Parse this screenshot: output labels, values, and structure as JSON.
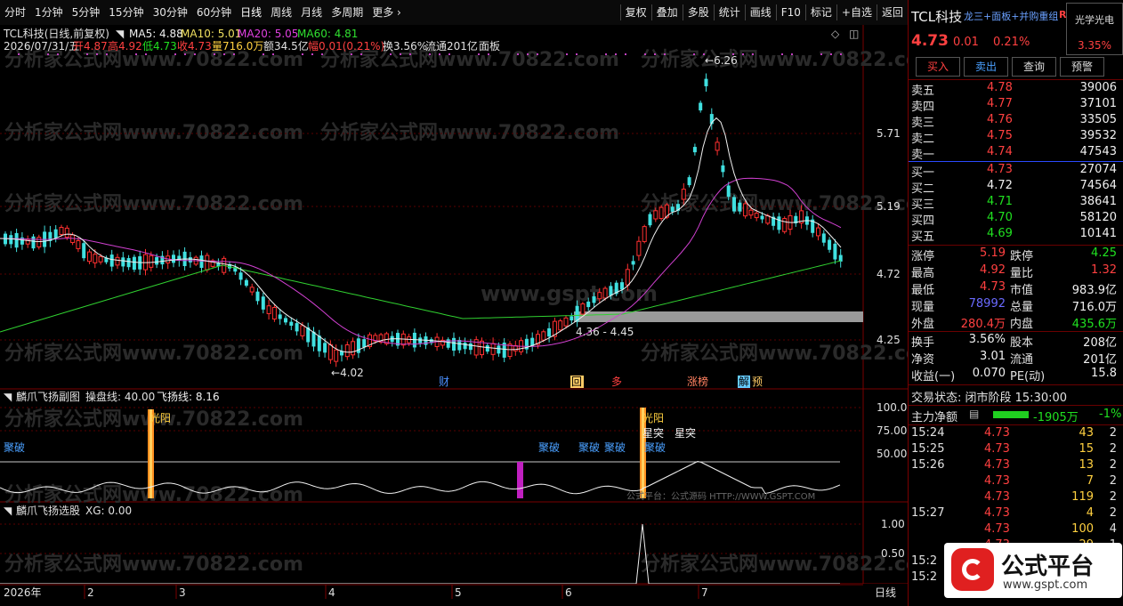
{
  "toolbar": {
    "tabs": [
      "分时",
      "1分钟",
      "5分钟",
      "15分钟",
      "30分钟",
      "60分钟",
      "日线",
      "周线",
      "月线",
      "多周期",
      "更多 ›"
    ],
    "active_tab": "日线",
    "tools": [
      "复权",
      "叠加",
      "多股",
      "统计",
      "画线",
      "F10",
      "标记",
      "+自选",
      "返回"
    ]
  },
  "main_chart": {
    "stock_line": "TCL科技(日线,前复权)",
    "ma5": "MA5: 4.88",
    "ma10": "MA10: 5.01",
    "ma20": "MA20: 5.05",
    "ma60": "MA60: 4.81",
    "info_date": "2026/07/31/五",
    "info_open": "开4.87",
    "info_high": "高4.92",
    "info_low": "低4.73",
    "info_close": "收4.73",
    "info_vol": "量716.0万",
    "info_amt": "额34.5亿",
    "info_chg": "幅0.01(0.21%)",
    "info_turn": "换3.56%",
    "info_float": "流通201亿",
    "info_board": "面板",
    "price_ticks": [
      "5.71",
      "5.19",
      "4.72",
      "4.25"
    ],
    "high_label": "6.26",
    "low_label": "4.02",
    "range_label": "4.36 - 4.45",
    "event_labels": [
      "财",
      "回",
      "多",
      "涨榜",
      "解",
      "预"
    ],
    "watermark_site": "分析家公式网www.70822.com",
    "watermark_center": "www.gspt.com"
  },
  "sub_chart_1": {
    "title": "麟爪飞扬副图",
    "param1": "操盘线: 40.00",
    "param2": "飞扬线: 8.16",
    "ticks": [
      "100.0",
      "75.00",
      "50.00"
    ],
    "labels": [
      "聚破",
      "光阳",
      "聚破",
      "聚破",
      "聚破",
      "光阳",
      "聚破",
      "星突",
      "星突"
    ],
    "footer": "公式平台：公式源码 HTTP://WWW.GSPT.COM"
  },
  "sub_chart_2": {
    "title": "麟爪飞扬选股",
    "param": "XG: 0.00",
    "ticks": [
      "1.00",
      "0.50"
    ]
  },
  "x_axis": {
    "labels": [
      "2026年",
      "2",
      "3",
      "4",
      "5",
      "6",
      "7"
    ],
    "period": "日线"
  },
  "quote": {
    "name": "TCL科技",
    "tags": "龙三+面板+并购重组",
    "r_badge": "R",
    "sector_name": "光学光电",
    "sector_pct": "3.35%",
    "price": "4.73",
    "change": "0.01",
    "pct": "0.21%",
    "buttons": [
      "买入",
      "卖出",
      "查询",
      "预警"
    ],
    "asks": [
      {
        "label": "卖五",
        "price": "4.78",
        "vol": "39006"
      },
      {
        "label": "卖四",
        "price": "4.77",
        "vol": "37101"
      },
      {
        "label": "卖三",
        "price": "4.76",
        "vol": "33505"
      },
      {
        "label": "卖二",
        "price": "4.75",
        "vol": "39532"
      },
      {
        "label": "卖一",
        "price": "4.74",
        "vol": "47543"
      }
    ],
    "bids": [
      {
        "label": "买一",
        "price": "4.73",
        "vol": "27074"
      },
      {
        "label": "买二",
        "price": "4.72",
        "vol": "74564"
      },
      {
        "label": "买三",
        "price": "4.71",
        "vol": "38641"
      },
      {
        "label": "买四",
        "price": "4.70",
        "vol": "58120"
      },
      {
        "label": "买五",
        "price": "4.69",
        "vol": "10141"
      }
    ],
    "stats": [
      {
        "k1": "涨停",
        "v1": "5.19",
        "k2": "跌停",
        "v2": "4.25"
      },
      {
        "k1": "最高",
        "v1": "4.92",
        "k2": "量比",
        "v2": "1.32"
      },
      {
        "k1": "最低",
        "v1": "4.73",
        "k2": "市值",
        "v2": "983.9亿"
      },
      {
        "k1": "现量",
        "v1": "78992",
        "k2": "总量",
        "v2": "716.0万"
      },
      {
        "k1": "外盘",
        "v1": "280.4万",
        "k2": "内盘",
        "v2": "435.6万"
      }
    ],
    "stats2": [
      {
        "k1": "换手",
        "v1": "3.56%",
        "k2": "股本",
        "v2": "208亿"
      },
      {
        "k1": "净资",
        "v1": "3.01",
        "k2": "流通",
        "v2": "201亿"
      },
      {
        "k1": "收益(一)",
        "v1": "0.070",
        "k2": "PE(动)",
        "v2": "15.8"
      }
    ],
    "status_label": "交易状态: 闭市阶段 15:30:00",
    "flow_label": "主力净额",
    "flow_value": "-1905万",
    "flow_pct": "-1%",
    "ticks": [
      {
        "t": "15:24",
        "p": "4.73",
        "v": "43",
        "n": "2"
      },
      {
        "t": "15:25",
        "p": "4.73",
        "v": "15",
        "n": "2"
      },
      {
        "t": "15:26",
        "p": "4.73",
        "v": "13",
        "n": "2"
      },
      {
        "t": "",
        "p": "4.73",
        "v": "7",
        "n": "2"
      },
      {
        "t": "",
        "p": "4.73",
        "v": "119",
        "n": "2"
      },
      {
        "t": "15:27",
        "p": "4.73",
        "v": "4",
        "n": "2"
      },
      {
        "t": "",
        "p": "4.73",
        "v": "100",
        "n": "4"
      },
      {
        "t": "",
        "p": "4.73",
        "v": "29",
        "n": "1"
      },
      {
        "t": "15:2",
        "p": "",
        "v": "",
        "n": ""
      },
      {
        "t": "15:2",
        "p": "",
        "v": "",
        "n": ""
      }
    ],
    "brand": "公式平台",
    "brand_url": "www.gspt.com"
  }
}
